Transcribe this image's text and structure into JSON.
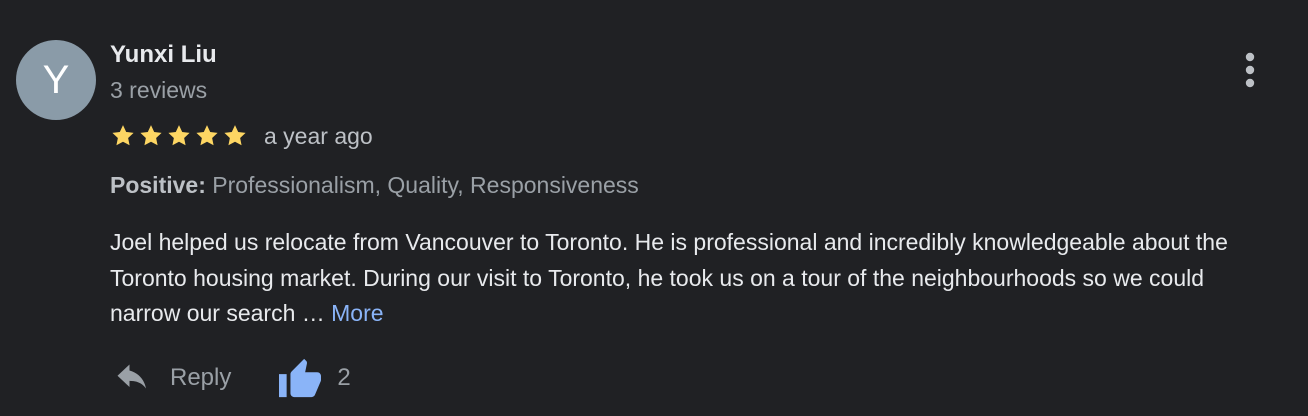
{
  "reviewer": {
    "initial": "Y",
    "name": "Yunxi Liu",
    "review_count": "3 reviews"
  },
  "rating": {
    "stars": 5,
    "max_stars": 5,
    "star_color": "#fdd663",
    "time_ago": "a year ago"
  },
  "attributes": {
    "label": "Positive:",
    "values": "Professionalism, Quality, Responsiveness"
  },
  "review": {
    "text": "Joel helped us relocate from Vancouver to Toronto. He is professional and incredibly knowledgeable about the Toronto housing market. During our visit to Toronto, he took us on a tour of the neighbourhoods so we could narrow our search … ",
    "more_label": "More"
  },
  "actions": {
    "reply_label": "Reply",
    "like_count": "2"
  },
  "colors": {
    "background": "#202124",
    "avatar": "#8a9ba8",
    "link": "#8ab4f8",
    "like_icon": "#8ab4f8",
    "muted": "#9aa0a6"
  },
  "icons": {
    "menu": "more-vert-icon",
    "reply": "reply-icon",
    "like": "thumb-up-icon",
    "star": "star-icon"
  }
}
